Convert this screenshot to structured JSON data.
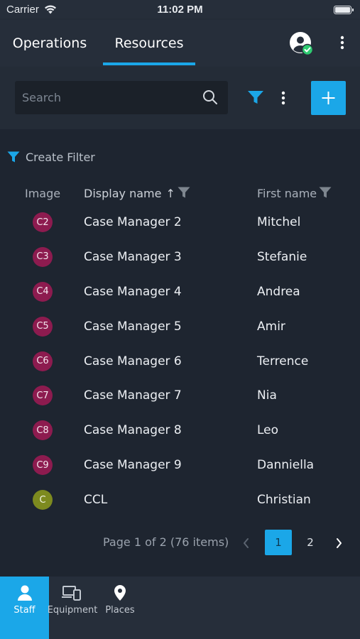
{
  "status_bar": {
    "carrier": "Carrier",
    "time": "11:02 PM"
  },
  "header": {
    "tabs": [
      {
        "label": "Operations",
        "active": false
      },
      {
        "label": "Resources",
        "active": true
      }
    ],
    "avatar_icon": "user-avatar-icon",
    "status_icon": "check-badge-icon",
    "more_icon": "more-vertical-icon"
  },
  "toolbar": {
    "search_placeholder": "Search",
    "search_value": "",
    "search_icon": "search-icon",
    "filter_icon": "filter-icon",
    "more_icon": "more-vertical-icon",
    "add_icon": "plus-icon"
  },
  "filter": {
    "create_label": "Create Filter"
  },
  "table": {
    "columns": {
      "image": "Image",
      "display_name": "Display name",
      "first_name": "First name"
    },
    "sort_indicator": "↑",
    "rows": [
      {
        "initials": "C2",
        "display_name": "Case Manager 2",
        "first_name": "Mitchel",
        "avatar_color": "#8d1b4f"
      },
      {
        "initials": "C3",
        "display_name": "Case Manager 3",
        "first_name": "Stefanie",
        "avatar_color": "#8d1b4f"
      },
      {
        "initials": "C4",
        "display_name": "Case Manager 4",
        "first_name": "Andrea",
        "avatar_color": "#8d1b4f"
      },
      {
        "initials": "C5",
        "display_name": "Case Manager 5",
        "first_name": "Amir",
        "avatar_color": "#8d1b4f"
      },
      {
        "initials": "C6",
        "display_name": "Case Manager 6",
        "first_name": "Terrence",
        "avatar_color": "#8d1b4f"
      },
      {
        "initials": "C7",
        "display_name": "Case Manager 7",
        "first_name": "Nia",
        "avatar_color": "#8d1b4f"
      },
      {
        "initials": "C8",
        "display_name": "Case Manager 8",
        "first_name": "Leo",
        "avatar_color": "#8d1b4f"
      },
      {
        "initials": "C9",
        "display_name": "Case Manager 9",
        "first_name": "Danniella",
        "avatar_color": "#8d1b4f"
      },
      {
        "initials": "C",
        "display_name": "CCL",
        "first_name": "Christian",
        "avatar_color": "#7d8a1f"
      }
    ]
  },
  "pagination": {
    "info": "Page 1 of 2 (76 items)",
    "pages": [
      "1",
      "2"
    ],
    "current_page": "1"
  },
  "bottom_nav": {
    "items": [
      {
        "label": "Staff",
        "icon": "person-icon",
        "active": true
      },
      {
        "label": "Equipment",
        "icon": "devices-icon",
        "active": false
      },
      {
        "label": "Places",
        "icon": "map-pin-icon",
        "active": false
      }
    ]
  },
  "colors": {
    "accent": "#1ba7e8",
    "background": "#1e2530",
    "header": "#262e3a",
    "success": "#2ecc71"
  }
}
